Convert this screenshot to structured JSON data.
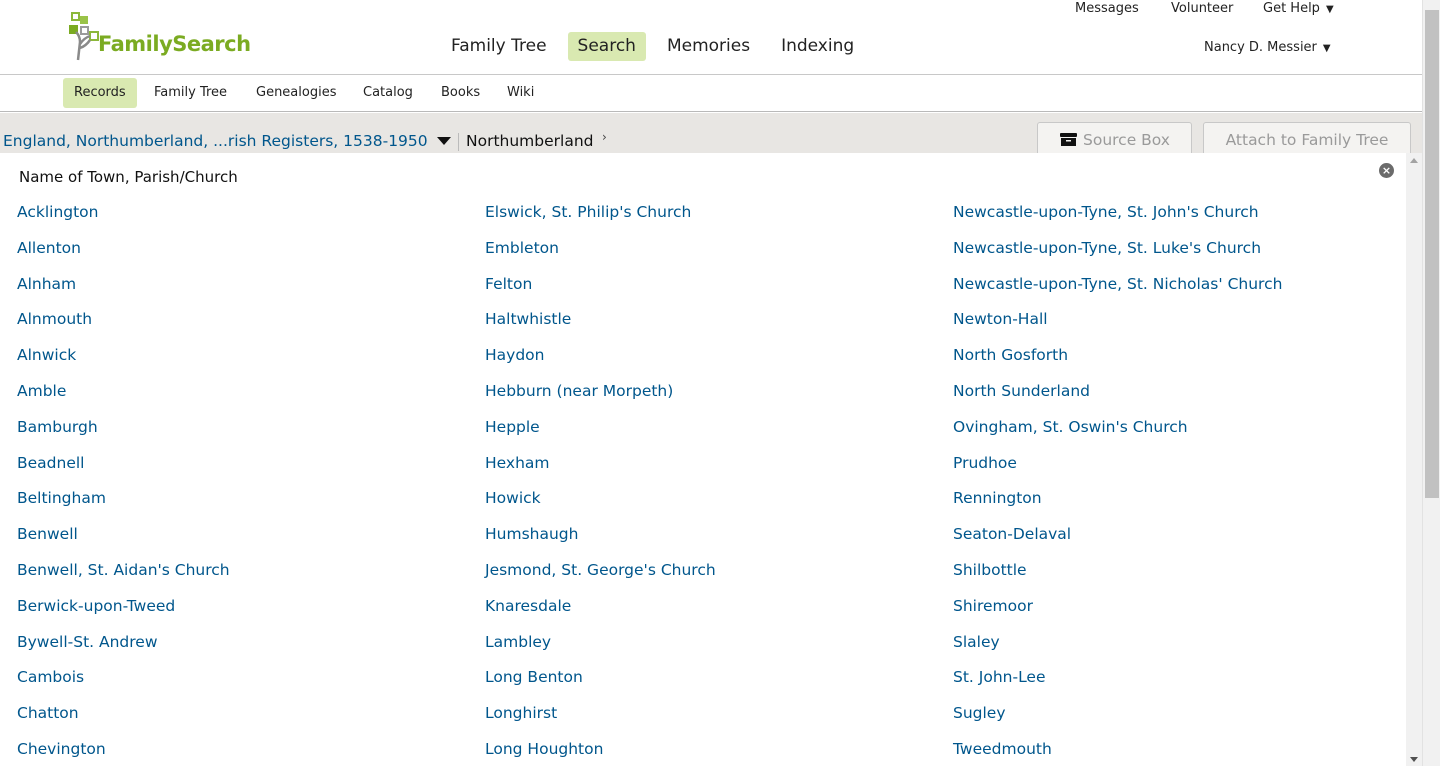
{
  "header": {
    "logo_text": "FamilySearch",
    "primary_nav": [
      {
        "label": "Family Tree",
        "active": false
      },
      {
        "label": "Search",
        "active": true
      },
      {
        "label": "Memories",
        "active": false
      },
      {
        "label": "Indexing",
        "active": false
      }
    ],
    "utility_nav": {
      "messages": "Messages",
      "volunteer": "Volunteer",
      "get_help": "Get Help"
    },
    "user_name": "Nancy D. Messier"
  },
  "subnav": [
    {
      "label": "Records",
      "active": true
    },
    {
      "label": "Family Tree",
      "active": false
    },
    {
      "label": "Genealogies",
      "active": false
    },
    {
      "label": "Catalog",
      "active": false
    },
    {
      "label": "Books",
      "active": false
    },
    {
      "label": "Wiki",
      "active": false
    }
  ],
  "breadcrumb": {
    "collection": "England, Northumberland, ...rish Registers, 1538-1950",
    "place": "Northumberland"
  },
  "actions": {
    "source_box": "Source Box",
    "attach": "Attach to Family Tree"
  },
  "panel": {
    "title": "Name of Town, Parish/Church",
    "columns": [
      [
        "Acklington",
        "Allenton",
        "Alnham",
        "Alnmouth",
        "Alnwick",
        "Amble",
        "Bamburgh",
        "Beadnell",
        "Beltingham",
        "Benwell",
        "Benwell, St. Aidan's Church",
        "Berwick-upon-Tweed",
        "Bywell-St. Andrew",
        "Cambois",
        "Chatton",
        "Chevington"
      ],
      [
        "Elswick, St. Philip's Church",
        "Embleton",
        "Felton",
        "Haltwhistle",
        "Haydon",
        "Hebburn (near Morpeth)",
        "Hepple",
        "Hexham",
        "Howick",
        "Humshaugh",
        "Jesmond, St. George's Church",
        "Knaresdale",
        "Lambley",
        "Long Benton",
        "Longhirst",
        "Long Houghton"
      ],
      [
        "Newcastle-upon-Tyne, St. John's Church",
        "Newcastle-upon-Tyne, St. Luke's Church",
        "Newcastle-upon-Tyne, St. Nicholas' Church",
        "Newton-Hall",
        "North Gosforth",
        "North Sunderland",
        "Ovingham, St. Oswin's Church",
        "Prudhoe",
        "Rennington",
        "Seaton-Delaval",
        "Shilbottle",
        "Shiremoor",
        "Slaley",
        "St. John-Lee",
        "Sugley",
        "Tweedmouth"
      ]
    ]
  },
  "colors": {
    "link": "#00568c",
    "active_tab": "#d9e9b1",
    "logo_green": "#7bab22",
    "breadcrumb_bar": "#e8e6e3"
  }
}
